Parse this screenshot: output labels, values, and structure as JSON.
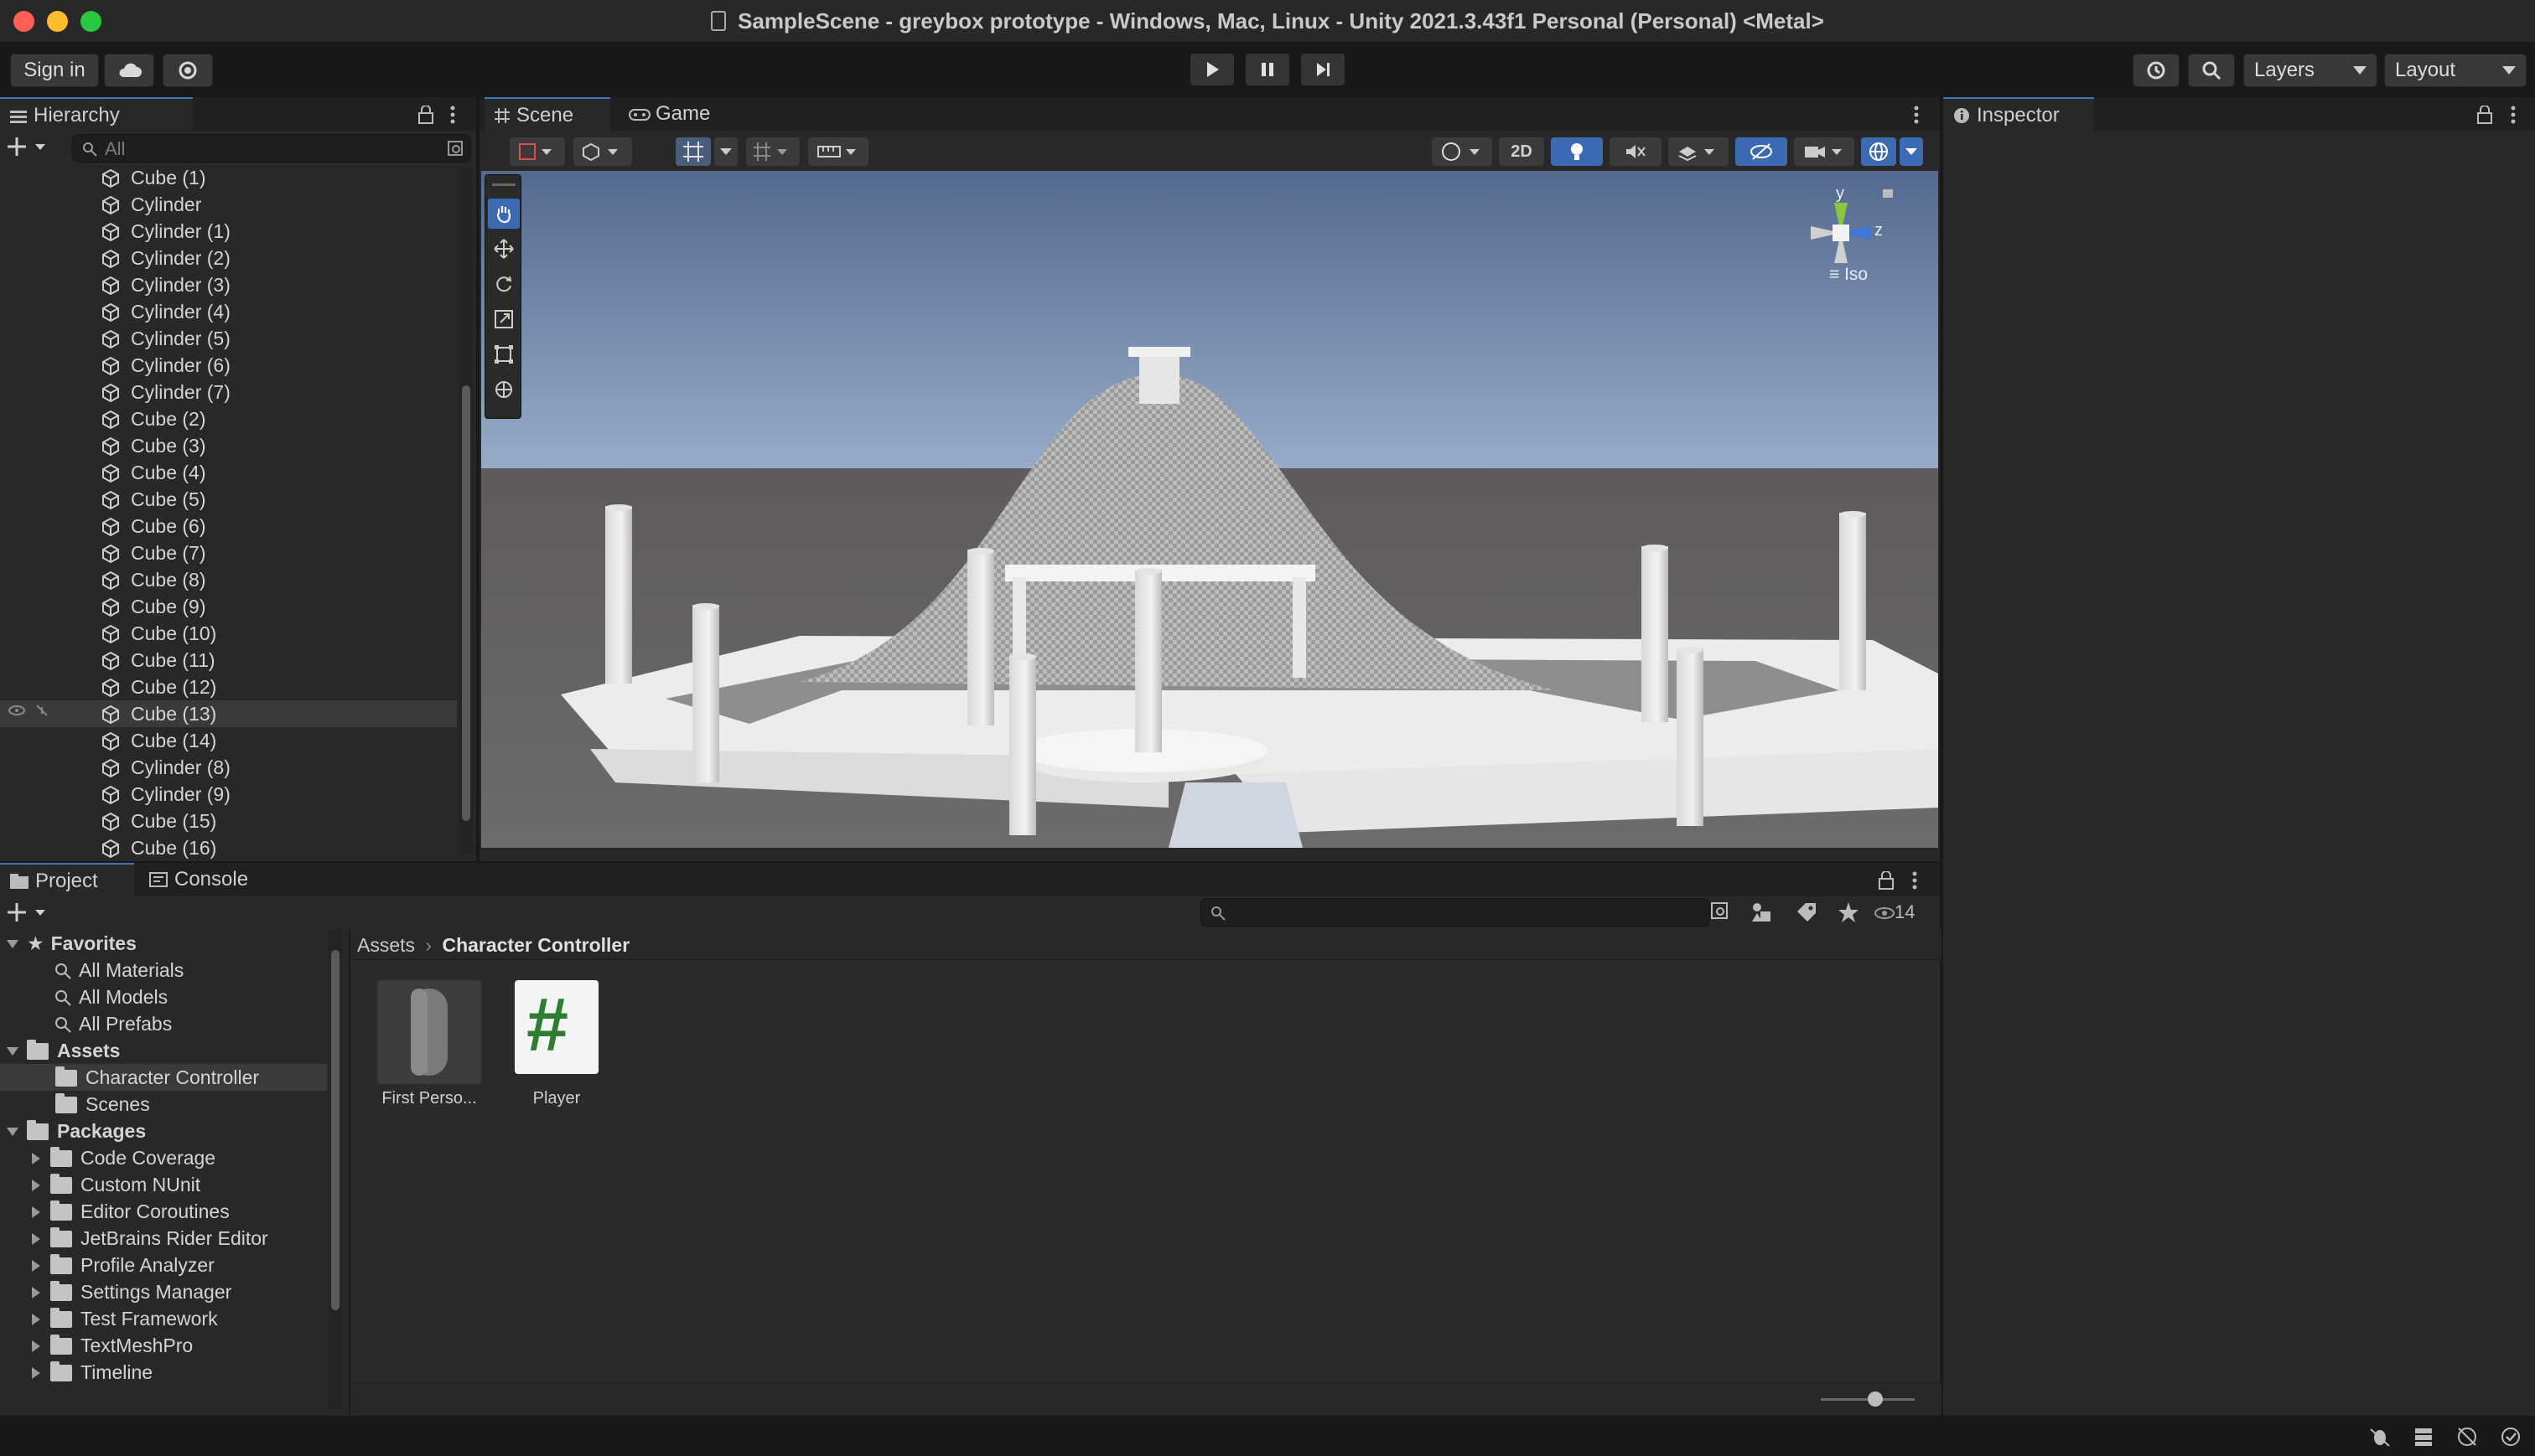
{
  "window": {
    "title": "SampleScene - greybox prototype - Windows, Mac, Linux - Unity 2021.3.43f1 Personal (Personal) <Metal>"
  },
  "toolbar": {
    "sign_in": "Sign in",
    "layers": "Layers",
    "layout": "Layout"
  },
  "hierarchy": {
    "tab": "Hierarchy",
    "search_placeholder": "All",
    "items": [
      "Cube (1)",
      "Cylinder",
      "Cylinder (1)",
      "Cylinder (2)",
      "Cylinder (3)",
      "Cylinder (4)",
      "Cylinder (5)",
      "Cylinder (6)",
      "Cylinder (7)",
      "Cube (2)",
      "Cube (3)",
      "Cube (4)",
      "Cube (5)",
      "Cube (6)",
      "Cube (7)",
      "Cube (8)",
      "Cube (9)",
      "Cube (10)",
      "Cube (11)",
      "Cube (12)",
      "Cube (13)",
      "Cube (14)",
      "Cylinder (8)",
      "Cylinder (9)",
      "Cube (15)",
      "Cube (16)"
    ],
    "selected_index": 20
  },
  "scene": {
    "tab_scene": "Scene",
    "tab_game": "Game",
    "btn_2d": "2D",
    "gizmo_y": "y",
    "gizmo_z": "z",
    "gizmo_iso": "Iso"
  },
  "inspector": {
    "tab": "Inspector"
  },
  "project": {
    "tab_project": "Project",
    "tab_console": "Console",
    "visible_count": "14",
    "favorites_label": "Favorites",
    "favorites": [
      "All Materials",
      "All Models",
      "All Prefabs"
    ],
    "assets_label": "Assets",
    "assets_children": [
      "Character Controller",
      "Scenes"
    ],
    "packages_label": "Packages",
    "packages": [
      "Code Coverage",
      "Custom NUnit",
      "Editor Coroutines",
      "JetBrains Rider Editor",
      "Profile Analyzer",
      "Settings Manager",
      "Test Framework",
      "TextMeshPro",
      "Timeline"
    ],
    "breadcrumb_root": "Assets",
    "breadcrumb_current": "Character Controller",
    "files": [
      {
        "name": "First Perso...",
        "icon": "capsule-prefab-icon"
      },
      {
        "name": "Player",
        "icon": "csharp-script-icon"
      }
    ]
  },
  "colors": {
    "accent": "#3a79bb",
    "panel": "#282828",
    "background": "#191919"
  }
}
